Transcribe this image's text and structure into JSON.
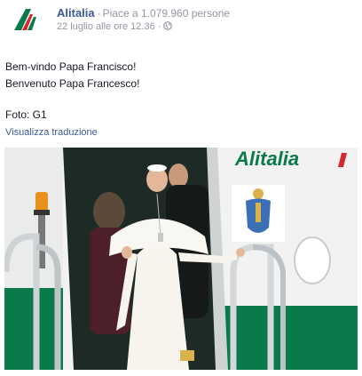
{
  "page": {
    "name": "Alitalia",
    "likes_text": "Piace a 1.079.960 persone",
    "separator": "·",
    "timestamp": "22 luglio alle ore 12.36",
    "audience_icon": "globe-icon"
  },
  "post": {
    "lines": [
      "Bem-vindo Papa Francisco!",
      "Benvenuto Papa Francesco!"
    ],
    "caption": "Foto: G1",
    "translate_link": "Visualizza traduzione"
  },
  "photo": {
    "aircraft_logo_text": "Alitalia",
    "colors": {
      "brand_green": "#0b7a4b",
      "brand_red": "#d7262e",
      "fuselage": "#f3f3f3",
      "door_dark": "#1e2a26",
      "cassock": "#f6f4ec"
    }
  }
}
